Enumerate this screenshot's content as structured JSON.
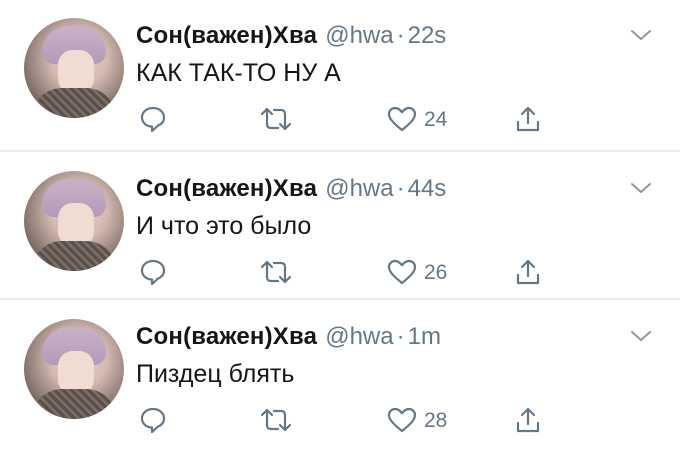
{
  "tweets": [
    {
      "author_name": "Сон(важен)Хва",
      "handle": "@hwa",
      "separator": "·",
      "time": "22s",
      "text": "КАК ТАК-ТО НУ А",
      "likes": "24"
    },
    {
      "author_name": "Сон(важен)Хва",
      "handle": "@hwa",
      "separator": "·",
      "time": "44s",
      "text": "И что это было",
      "likes": "26"
    },
    {
      "author_name": "Сон(важен)Хва",
      "handle": "@hwa",
      "separator": "·",
      "time": "1m",
      "text": "Пиздец блять",
      "likes": "28"
    }
  ],
  "icons": {
    "menu": "chevron-down-icon",
    "reply": "reply-icon",
    "retweet": "retweet-icon",
    "like": "heart-icon",
    "share": "share-icon"
  },
  "colors": {
    "text": "#14171a",
    "secondary": "#657786",
    "icon": "#657786",
    "divider": "#e6ecf0"
  }
}
